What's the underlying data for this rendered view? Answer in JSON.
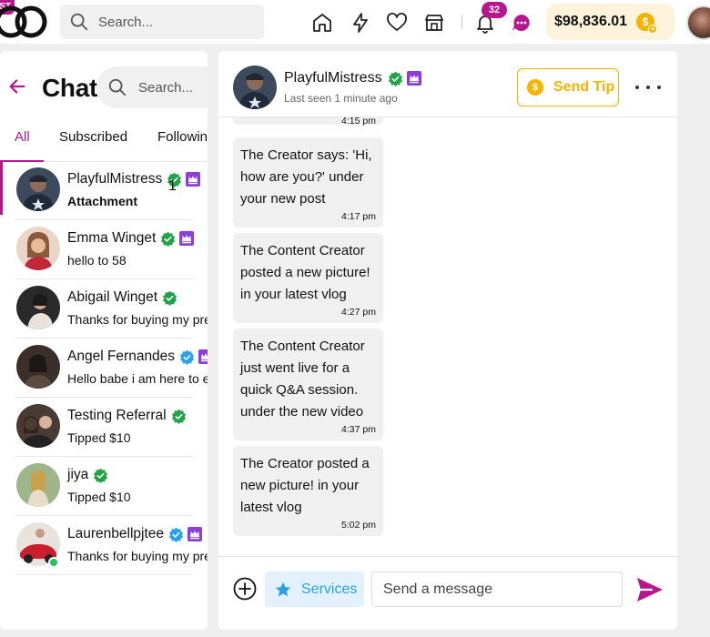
{
  "topbar": {
    "logo_badge": "ST",
    "search_placeholder": "Search...",
    "notifications_count": "32",
    "wallet_amount": "$98,836.01",
    "wallet_coin_symbol": "$",
    "icons": [
      "home-icon",
      "lightning-icon",
      "heart-icon",
      "store-icon",
      "bell-icon",
      "messages-icon",
      "coin-icon",
      "avatar"
    ]
  },
  "sidebar": {
    "title": "Chat",
    "search_placeholder": "Search...",
    "tabs": [
      {
        "label": "All",
        "active": true
      },
      {
        "label": "Subscribed",
        "active": false
      },
      {
        "label": "Following",
        "active": false
      }
    ],
    "conversations": [
      {
        "name": "PlayfulMistress",
        "preview": "Attachment",
        "bold": true,
        "verified": "green",
        "crown": true,
        "unread": "1",
        "selected": true,
        "online": false
      },
      {
        "name": "Emma Winget",
        "preview": "hello to 58",
        "bold": false,
        "verified": "green",
        "crown": true,
        "online": false
      },
      {
        "name": "Abigail Winget",
        "preview": "Thanks for buying my premium content",
        "bold": false,
        "verified": "green",
        "crown": false,
        "online": false
      },
      {
        "name": "Angel Fernandes",
        "preview": "Hello babe i am here to entertain you",
        "bold": false,
        "verified": "blue",
        "crown": true,
        "online": false
      },
      {
        "name": "Testing Referral",
        "preview": "Tipped $10",
        "bold": false,
        "verified": "green",
        "crown": false,
        "online": false
      },
      {
        "name": "jiya",
        "preview": "Tipped $10",
        "bold": false,
        "verified": "green",
        "crown": false,
        "online": false
      },
      {
        "name": "Laurenbellpjtee",
        "preview": "Thanks for buying my premium content",
        "bold": false,
        "verified": "blue",
        "crown": true,
        "online": true
      }
    ]
  },
  "chat": {
    "name": "PlayfulMistress",
    "last_seen": "Last seen 1 minute ago",
    "send_tip_label": "Send Tip",
    "tip_coin_symbol": "$",
    "messages": [
      {
        "text": "",
        "time": "4:15 pm"
      },
      {
        "text": "The Creator says: 'Hi, how are you?' under your new post",
        "time": "4:17 pm"
      },
      {
        "text": "The Content Creator posted a new picture! in your latest vlog",
        "time": "4:27 pm"
      },
      {
        "text": "The Content Creator just went live for a quick Q&A session. under the new video",
        "time": "4:37 pm"
      },
      {
        "text": "The Creator posted a new picture! in your latest vlog",
        "time": "5:02 pm"
      }
    ],
    "services_label": "Services",
    "message_placeholder": "Send a message"
  },
  "colors": {
    "accent": "#b5178e",
    "gold": "#f5b400",
    "verified_green": "#22a34a",
    "verified_blue": "#2aa0e6",
    "crown_purple": "#8b3fd9",
    "services_blue": "#2aa0e6"
  }
}
